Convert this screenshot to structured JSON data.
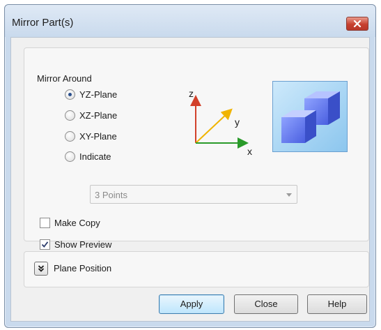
{
  "window": {
    "title": "Mirror Part(s)"
  },
  "mirror": {
    "group_label": "Mirror Around",
    "options": [
      {
        "label": "YZ-Plane",
        "selected": true
      },
      {
        "label": "XZ-Plane",
        "selected": false
      },
      {
        "label": "XY-Plane",
        "selected": false
      },
      {
        "label": "Indicate",
        "selected": false
      }
    ],
    "method_dropdown": {
      "value": "3 Points",
      "enabled": false
    },
    "make_copy": {
      "label": "Make Copy",
      "checked": false
    },
    "show_preview": {
      "label": "Show Preview",
      "checked": true
    },
    "axes": {
      "z": "z",
      "y": "y",
      "x": "x"
    }
  },
  "plane_position": {
    "label": "Plane Position"
  },
  "buttons": {
    "apply": "Apply",
    "close": "Close",
    "help": "Help"
  },
  "colors": {
    "x_axis": "#2a9a2a",
    "y_axis": "#f0b400",
    "z_axis": "#d2402a",
    "accent": "#3c7fb1"
  }
}
